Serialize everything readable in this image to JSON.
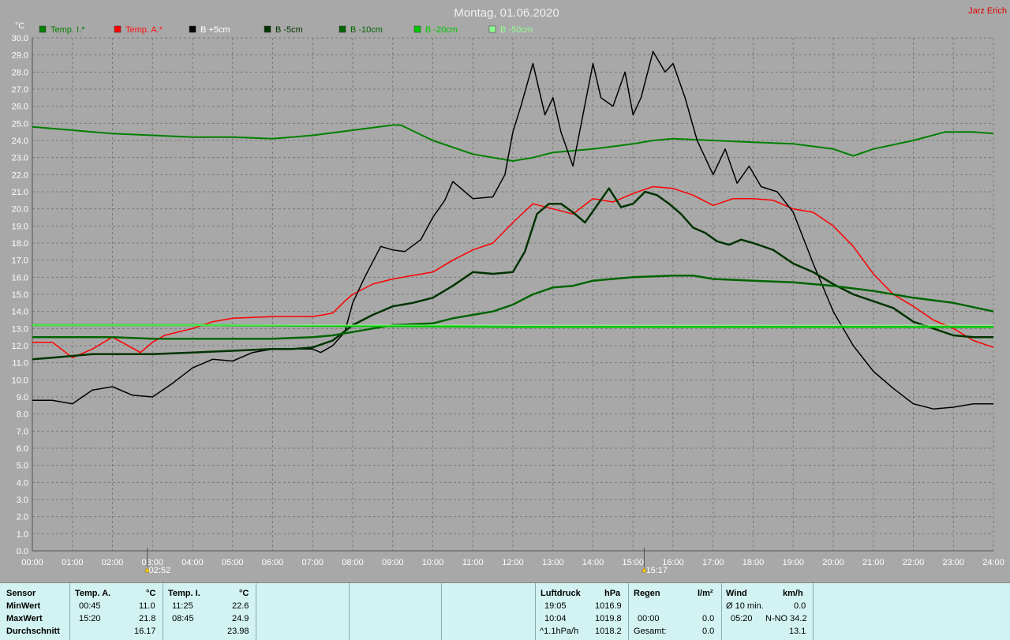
{
  "header": {
    "title": "Montag, 01.06.2020",
    "author": "Jarz Erich",
    "unit": "°C"
  },
  "chart_data": {
    "type": "line",
    "title": "Montag, 01.06.2020",
    "ylabel": "°C",
    "ylim": [
      0,
      30
    ],
    "xlim": [
      0,
      24
    ],
    "grid": true,
    "legend_position": "top",
    "y_ticks": [
      "0.0",
      "1.0",
      "2.0",
      "3.0",
      "4.0",
      "5.0",
      "6.0",
      "7.0",
      "8.0",
      "9.0",
      "10.0",
      "11.0",
      "12.0",
      "13.0",
      "14.0",
      "15.0",
      "16.0",
      "17.0",
      "18.0",
      "19.0",
      "20.0",
      "21.0",
      "22.0",
      "23.0",
      "24.0",
      "25.0",
      "26.0",
      "27.0",
      "28.0",
      "29.0",
      "30.0"
    ],
    "x_ticks": [
      "00:00",
      "01:00",
      "02:00",
      "03:00",
      "04:00",
      "05:00",
      "06:00",
      "07:00",
      "08:00",
      "09:00",
      "10:00",
      "11:00",
      "12:00",
      "13:00",
      "14:00",
      "15:00",
      "16:00",
      "17:00",
      "18:00",
      "19:00",
      "20:00",
      "21:00",
      "22:00",
      "23:00",
      "24:00"
    ],
    "markers": [
      {
        "label": "02:52",
        "x": 2.87
      },
      {
        "label": "15:17",
        "x": 15.28
      }
    ],
    "series": [
      {
        "name": "Temp. I.*",
        "color": "#008000",
        "width": 2,
        "x": [
          0,
          1,
          2,
          3,
          4,
          5,
          6,
          7,
          8,
          9,
          9.2,
          10,
          11,
          12,
          12.5,
          13,
          14,
          15,
          15.5,
          16,
          17,
          18,
          19,
          20,
          20.5,
          21,
          22,
          22.8,
          23.5,
          24
        ],
        "y": [
          24.8,
          24.6,
          24.4,
          24.3,
          24.2,
          24.2,
          24.1,
          24.3,
          24.6,
          24.9,
          24.9,
          24.0,
          23.2,
          22.8,
          23.0,
          23.3,
          23.5,
          23.8,
          24.0,
          24.1,
          24.0,
          23.9,
          23.8,
          23.5,
          23.1,
          23.5,
          24.0,
          24.5,
          24.5,
          24.4
        ]
      },
      {
        "name": "Temp. A.*",
        "color": "#ff0000",
        "width": 1.5,
        "x": [
          0,
          0.5,
          1,
          1.5,
          2,
          2.7,
          3,
          3.3,
          4,
          4.5,
          5,
          6,
          7,
          7.5,
          7.8,
          8,
          8.5,
          9,
          10,
          10.5,
          11,
          11.5,
          12,
          12.5,
          13,
          13.5,
          14,
          14.5,
          15,
          15.5,
          16,
          16.5,
          17,
          17.5,
          18,
          18.5,
          19,
          19.5,
          20,
          20.5,
          21,
          21.5,
          22,
          22.5,
          23,
          23.5,
          24
        ],
        "y": [
          12.2,
          12.2,
          11.3,
          11.8,
          12.5,
          11.6,
          12.2,
          12.6,
          13.0,
          13.4,
          13.6,
          13.7,
          13.7,
          13.9,
          14.6,
          15.0,
          15.6,
          15.9,
          16.3,
          17.0,
          17.6,
          18.0,
          19.2,
          20.3,
          20.0,
          19.7,
          20.6,
          20.4,
          20.9,
          21.3,
          21.2,
          20.8,
          20.2,
          20.6,
          20.6,
          20.5,
          20.0,
          19.8,
          19.0,
          17.8,
          16.2,
          15.0,
          14.3,
          13.5,
          13.0,
          12.3,
          11.9
        ]
      },
      {
        "name": "B +5cm",
        "color": "#000000",
        "width": 1.5,
        "x": [
          0,
          0.5,
          1,
          1.5,
          2,
          2.5,
          3,
          3.5,
          4,
          4.5,
          5,
          5.5,
          6,
          6.5,
          7,
          7.2,
          7.5,
          7.8,
          8,
          8.3,
          8.7,
          9,
          9.3,
          9.7,
          10,
          10.3,
          10.5,
          11,
          11.5,
          11.8,
          12,
          12.2,
          12.5,
          12.8,
          13,
          13.2,
          13.5,
          14,
          14.2,
          14.5,
          14.8,
          15,
          15.2,
          15.5,
          15.8,
          16,
          16.3,
          16.6,
          16.9,
          17,
          17.3,
          17.6,
          17.9,
          18.2,
          18.6,
          19,
          19.5,
          20,
          20.5,
          21,
          21.5,
          22,
          22.5,
          23,
          23.5,
          24
        ],
        "y": [
          8.8,
          8.8,
          8.6,
          9.4,
          9.6,
          9.1,
          9.0,
          9.8,
          10.7,
          11.2,
          11.1,
          11.6,
          11.8,
          11.8,
          11.8,
          11.6,
          12.0,
          12.8,
          14.5,
          16.0,
          17.8,
          17.6,
          17.5,
          18.2,
          19.5,
          20.5,
          21.6,
          20.6,
          20.7,
          22.0,
          24.5,
          26.0,
          28.5,
          25.5,
          26.5,
          24.5,
          22.5,
          28.5,
          26.5,
          26.0,
          28.0,
          25.5,
          26.5,
          29.2,
          28.0,
          28.5,
          26.5,
          24.0,
          22.5,
          22.0,
          23.5,
          21.5,
          22.5,
          21.3,
          21.0,
          19.8,
          16.8,
          14.0,
          12.0,
          10.5,
          9.5,
          8.6,
          8.3,
          8.4,
          8.6,
          8.6
        ]
      },
      {
        "name": "B -5cm",
        "color": "#003300",
        "width": 2.5,
        "x": [
          0,
          0.5,
          1,
          1.5,
          2,
          3,
          4,
          5,
          6,
          6.5,
          7,
          7.5,
          8,
          8.5,
          9,
          9.5,
          10,
          10.5,
          11,
          11.5,
          12,
          12.3,
          12.6,
          12.9,
          13.2,
          13.5,
          13.8,
          14.1,
          14.4,
          14.7,
          15,
          15.3,
          15.6,
          15.9,
          16.2,
          16.5,
          16.8,
          17.1,
          17.4,
          17.7,
          18,
          18.5,
          19,
          19.5,
          20,
          20.5,
          21,
          21.5,
          22,
          22.5,
          23,
          23.5,
          24
        ],
        "y": [
          11.2,
          11.3,
          11.4,
          11.5,
          11.5,
          11.5,
          11.6,
          11.7,
          11.8,
          11.8,
          11.9,
          12.3,
          13.2,
          13.8,
          14.3,
          14.5,
          14.8,
          15.5,
          16.3,
          16.2,
          16.3,
          17.5,
          19.7,
          20.3,
          20.3,
          19.8,
          19.2,
          20.2,
          21.2,
          20.1,
          20.3,
          21.0,
          20.8,
          20.3,
          19.7,
          18.9,
          18.6,
          18.1,
          17.9,
          18.2,
          18.0,
          17.6,
          16.8,
          16.3,
          15.6,
          15.0,
          14.6,
          14.2,
          13.4,
          13.0,
          12.6,
          12.5,
          12.5
        ]
      },
      {
        "name": "B -10cm",
        "color": "#006400",
        "width": 2.5,
        "x": [
          0,
          1,
          2,
          3,
          4,
          5,
          6,
          7,
          7.5,
          8,
          8.5,
          9,
          10,
          10.5,
          11,
          11.5,
          12,
          12.5,
          13,
          13.5,
          14,
          15,
          16,
          16.5,
          17,
          18,
          19,
          20,
          21,
          22,
          23,
          24
        ],
        "y": [
          12.5,
          12.5,
          12.5,
          12.4,
          12.4,
          12.4,
          12.4,
          12.5,
          12.6,
          12.8,
          13.0,
          13.2,
          13.3,
          13.6,
          13.8,
          14.0,
          14.4,
          15.0,
          15.4,
          15.5,
          15.8,
          16.0,
          16.1,
          16.1,
          15.9,
          15.8,
          15.7,
          15.5,
          15.2,
          14.8,
          14.5,
          14.0
        ]
      },
      {
        "name": "B -20cm",
        "color": "#00c800",
        "width": 2.5,
        "x": [
          0,
          4,
          8,
          12,
          16,
          20,
          24
        ],
        "y": [
          13.2,
          13.2,
          13.15,
          13.1,
          13.1,
          13.1,
          13.1
        ]
      },
      {
        "name": "B -50cm",
        "color": "#90ff90",
        "width": 1,
        "x": [
          0,
          24
        ],
        "y": [
          13.2,
          13.2
        ]
      }
    ]
  },
  "stats": {
    "col1": {
      "header": "Sensor",
      "rows": [
        "MinWert",
        "MaxWert",
        "Durchschnitt"
      ]
    },
    "temp_a": {
      "header": "Temp. A.",
      "unit": "°C",
      "min_time": "00:45",
      "min_val": "11.0",
      "max_time": "15:20",
      "max_val": "21.8",
      "avg": "16.17"
    },
    "temp_i": {
      "header": "Temp. I.",
      "unit": "°C",
      "min_time": "11:25",
      "min_val": "22.6",
      "max_time": "08:45",
      "max_val": "24.9",
      "avg": "23.98"
    },
    "luftdruck": {
      "header": "Luftdruck",
      "unit": "hPa",
      "min_time": "19:05",
      "min_val": "1016.9",
      "max_time": "10:04",
      "max_val": "1019.8",
      "trend": "^1.1hPa/h",
      "trend_val": "1018.2"
    },
    "regen": {
      "header": "Regen",
      "unit": "l/m²",
      "max_time": "00:00",
      "max_val": "0.0",
      "total_label": "Gesamt:",
      "total_val": "0.0"
    },
    "wind": {
      "header": "Wind",
      "unit": "km/h",
      "avg_label": "Ø 10 min.",
      "avg_val": "0.0",
      "max_time": "05:20",
      "max_val": "N-NO 34.2",
      "avg2": "13.1"
    }
  }
}
